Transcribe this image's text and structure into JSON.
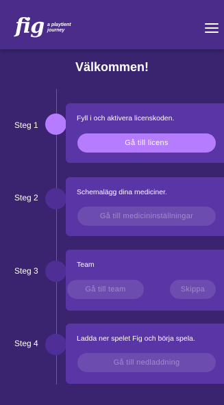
{
  "header": {
    "logo": "fig",
    "logo_tagline_1": "a playtient",
    "logo_tagline_2": "journey",
    "menu_icon": "hamburger-icon"
  },
  "page": {
    "title": "Välkommen!"
  },
  "steps": [
    {
      "label": "Steg 1",
      "text": "Fyll i och aktivera licenskoden.",
      "buttons": [
        {
          "label": "Gå till licens",
          "enabled": true
        }
      ],
      "active": true
    },
    {
      "label": "Steg 2",
      "text": "Schemalägg dina mediciner.",
      "buttons": [
        {
          "label": "Gå till medicininställningar",
          "enabled": false
        }
      ],
      "active": false
    },
    {
      "label": "Steg 3",
      "text": "Team",
      "buttons": [
        {
          "label": "Gå till team",
          "enabled": false
        },
        {
          "label": "Skippa",
          "enabled": false
        }
      ],
      "active": false
    },
    {
      "label": "Steg 4",
      "text": "Ladda ner spelet Fig och börja spela.",
      "buttons": [
        {
          "label": "Gå till nedladdning",
          "enabled": false
        }
      ],
      "active": false
    }
  ],
  "colors": {
    "background": "#3a2470",
    "header": "#4c2c8a",
    "card": "#5a35a5",
    "accent": "#b57cff",
    "disabled_button": "#6d4cb0"
  }
}
